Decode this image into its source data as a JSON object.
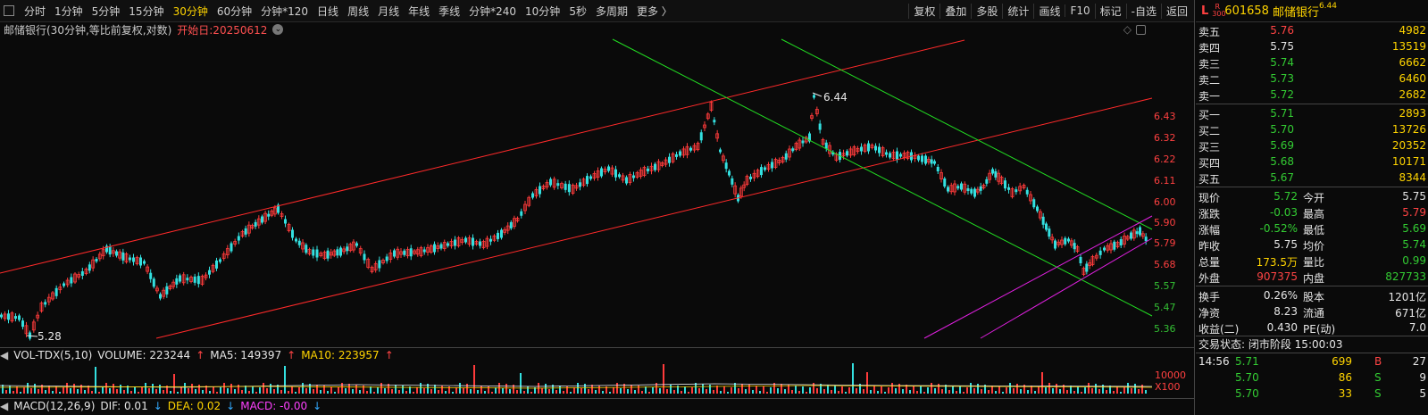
{
  "toolbar": {
    "periods": [
      "分时",
      "1分钟",
      "5分钟",
      "15分钟",
      "30分钟",
      "60分钟",
      "分钟*120",
      "日线",
      "周线",
      "月线",
      "年线",
      "季线",
      "分钟*240",
      "10分钟",
      "5秒",
      "多周期",
      "更多 〉"
    ],
    "active_period": "30分钟",
    "tools": [
      "复权",
      "叠加",
      "多股",
      "统计",
      "画线",
      "F10",
      "标记",
      "-自选",
      "返回"
    ]
  },
  "chart": {
    "title": "邮储银行(30分钟,等比前复权,对数)",
    "start_label": "开始日:20250612",
    "high_mark": "6.44",
    "low_mark": "5.28",
    "y_ticks": [
      {
        "v": "6.43",
        "c": "red"
      },
      {
        "v": "6.32",
        "c": "red"
      },
      {
        "v": "6.22",
        "c": "red"
      },
      {
        "v": "6.11",
        "c": "red"
      },
      {
        "v": "6.00",
        "c": "red"
      },
      {
        "v": "5.90",
        "c": "red"
      },
      {
        "v": "5.79",
        "c": "red"
      },
      {
        "v": "5.68",
        "c": "red"
      },
      {
        "v": "5.57",
        "c": "green"
      },
      {
        "v": "5.47",
        "c": "green"
      },
      {
        "v": "5.36",
        "c": "green"
      }
    ],
    "vol_ticks": [
      "10000",
      "X100"
    ]
  },
  "volume_header": {
    "name": "VOL-TDX(5,10)",
    "volume": "VOLUME: 223244",
    "ma5": "MA5: 149397",
    "ma10": "MA10: 223957",
    "volume_color": "#e6e6e6",
    "ma5_color": "#e6e6e6",
    "ma10_color": "#ffd400"
  },
  "macd_header": {
    "name": "MACD(12,26,9)",
    "dif": "DIF: 0.01",
    "dea": "DEA: 0.02",
    "macd": "MACD: -0.00",
    "dif_color": "#e6e6e6",
    "dea_color": "#ffd400",
    "macd_color": "#ff40ff"
  },
  "quote": {
    "market": "L",
    "badge_top": "R",
    "badge_bottom": "300",
    "code": "601658",
    "name": "邮储银行",
    "price_tag": "6.44",
    "asks": [
      {
        "label": "卖五",
        "price": "5.76",
        "vol": "4982",
        "pc": "red"
      },
      {
        "label": "卖四",
        "price": "5.75",
        "vol": "13519",
        "pc": "white"
      },
      {
        "label": "卖三",
        "price": "5.74",
        "vol": "6662",
        "pc": "green"
      },
      {
        "label": "卖二",
        "price": "5.73",
        "vol": "6460",
        "pc": "green"
      },
      {
        "label": "卖一",
        "price": "5.72",
        "vol": "2682",
        "pc": "green"
      }
    ],
    "bids": [
      {
        "label": "买一",
        "price": "5.71",
        "vol": "2893",
        "pc": "green"
      },
      {
        "label": "买二",
        "price": "5.70",
        "vol": "13726",
        "pc": "green"
      },
      {
        "label": "买三",
        "price": "5.69",
        "vol": "20352",
        "pc": "green"
      },
      {
        "label": "买四",
        "price": "5.68",
        "vol": "10171",
        "pc": "green"
      },
      {
        "label": "买五",
        "price": "5.67",
        "vol": "8344",
        "pc": "green"
      }
    ],
    "stats": [
      {
        "l1": "现价",
        "v1": "5.72",
        "c1": "green",
        "l2": "今开",
        "v2": "5.75",
        "c2": "white"
      },
      {
        "l1": "涨跌",
        "v1": "-0.03",
        "c1": "green",
        "l2": "最高",
        "v2": "5.79",
        "c2": "red"
      },
      {
        "l1": "涨幅",
        "v1": "-0.52%",
        "c1": "green",
        "l2": "最低",
        "v2": "5.69",
        "c2": "green"
      },
      {
        "l1": "昨收",
        "v1": "5.75",
        "c1": "white",
        "l2": "均价",
        "v2": "5.74",
        "c2": "green"
      },
      {
        "l1": "总量",
        "v1": "173.5万",
        "c1": "yellow",
        "l2": "量比",
        "v2": "0.99",
        "c2": "green"
      },
      {
        "l1": "外盘",
        "v1": "907375",
        "c1": "red",
        "l2": "内盘",
        "v2": "827733",
        "c2": "green"
      }
    ],
    "stats2": [
      {
        "l1": "换手",
        "v1": "0.26%",
        "c1": "white",
        "l2": "股本",
        "v2": "1201亿",
        "c2": "white"
      },
      {
        "l1": "净资",
        "v1": "8.23",
        "c1": "white",
        "l2": "流通",
        "v2": "671亿",
        "c2": "white"
      },
      {
        "l1": "收益(二)",
        "v1": "0.430",
        "c1": "white",
        "l2": "PE(动)",
        "v2": "7.0",
        "c2": "white"
      }
    ],
    "status": "交易状态: 闭市阶段 15:00:03",
    "ticks": [
      {
        "time": "14:56",
        "price": "5.71",
        "vol": "699",
        "dir": "B",
        "num": "27"
      },
      {
        "time": "",
        "price": "5.70",
        "vol": "86",
        "dir": "S",
        "num": "9"
      },
      {
        "time": "",
        "price": "5.70",
        "vol": "33",
        "dir": "S",
        "num": "5"
      }
    ]
  }
}
